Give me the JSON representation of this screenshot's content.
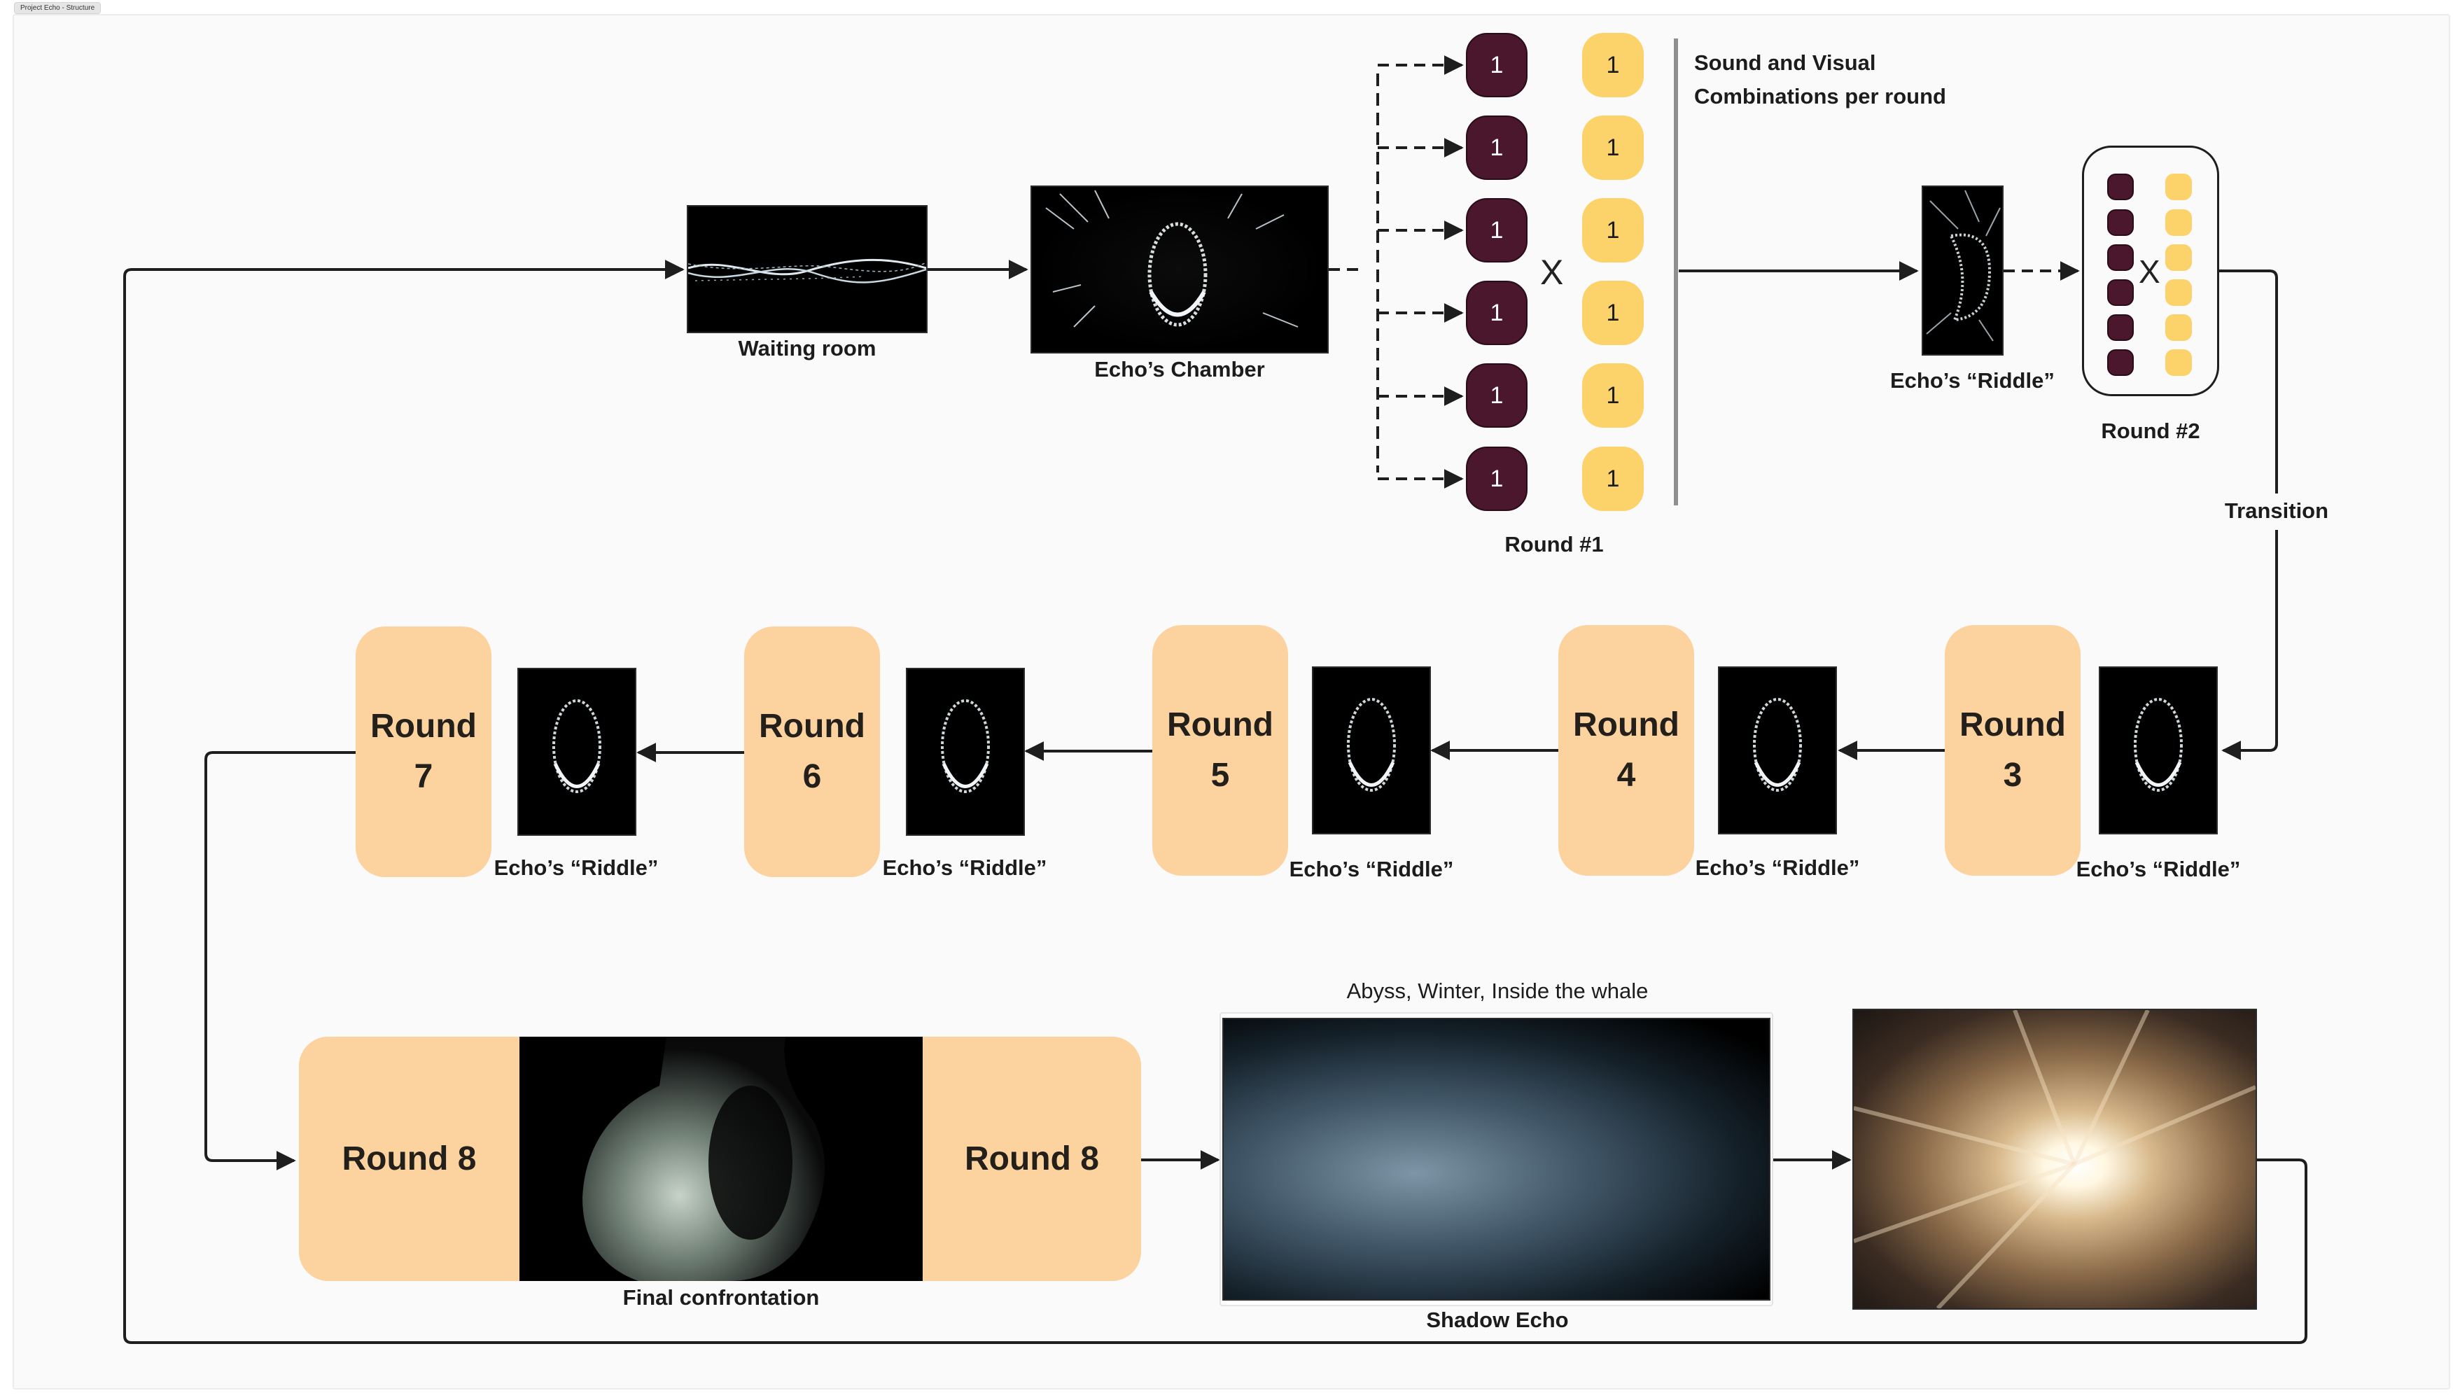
{
  "canvas_tab": {
    "label": "Project Echo - Structure"
  },
  "colors": {
    "sound_pill": "#4a172d",
    "visual_pill": "#fcd36b",
    "round_box": "#fcd29e",
    "connector": "#1e1e1e",
    "divider": "#8f8f8f"
  },
  "nodes": {
    "waiting_room": {
      "label": "Waiting room"
    },
    "echo_chamber": {
      "label": "Echo’s Chamber"
    },
    "round1": {
      "label": "Round #1",
      "sound_values": [
        "1",
        "1",
        "1",
        "1",
        "1",
        "1"
      ],
      "visual_values": [
        "1",
        "1",
        "1",
        "1",
        "1",
        "1"
      ],
      "operator": "X",
      "note_line1": "Sound and Visual",
      "note_line2": "Combinations per round"
    },
    "riddle_round2": {
      "label": "Echo’s “Riddle”"
    },
    "round2": {
      "label": "Round #2",
      "operator": "X",
      "sound_count": 6,
      "visual_count": 6
    },
    "transition": {
      "label": "Transition"
    },
    "rounds_row": [
      {
        "line1": "Round",
        "line2": "3",
        "riddle_label": "Echo’s “Riddle”"
      },
      {
        "line1": "Round",
        "line2": "4",
        "riddle_label": "Echo’s “Riddle”"
      },
      {
        "line1": "Round",
        "line2": "5",
        "riddle_label": "Echo’s “Riddle”"
      },
      {
        "line1": "Round",
        "line2": "6",
        "riddle_label": "Echo’s “Riddle”"
      },
      {
        "line1": "Round",
        "line2": "7",
        "riddle_label": "Echo’s “Riddle”"
      }
    ],
    "round8": {
      "left_label": "Round 8",
      "right_label": "Round 8",
      "caption": "Final confrontation"
    },
    "shadow_echo": {
      "caption": "Shadow Echo",
      "title": "Abyss, Winter, Inside the whale"
    },
    "light_burst": {}
  }
}
